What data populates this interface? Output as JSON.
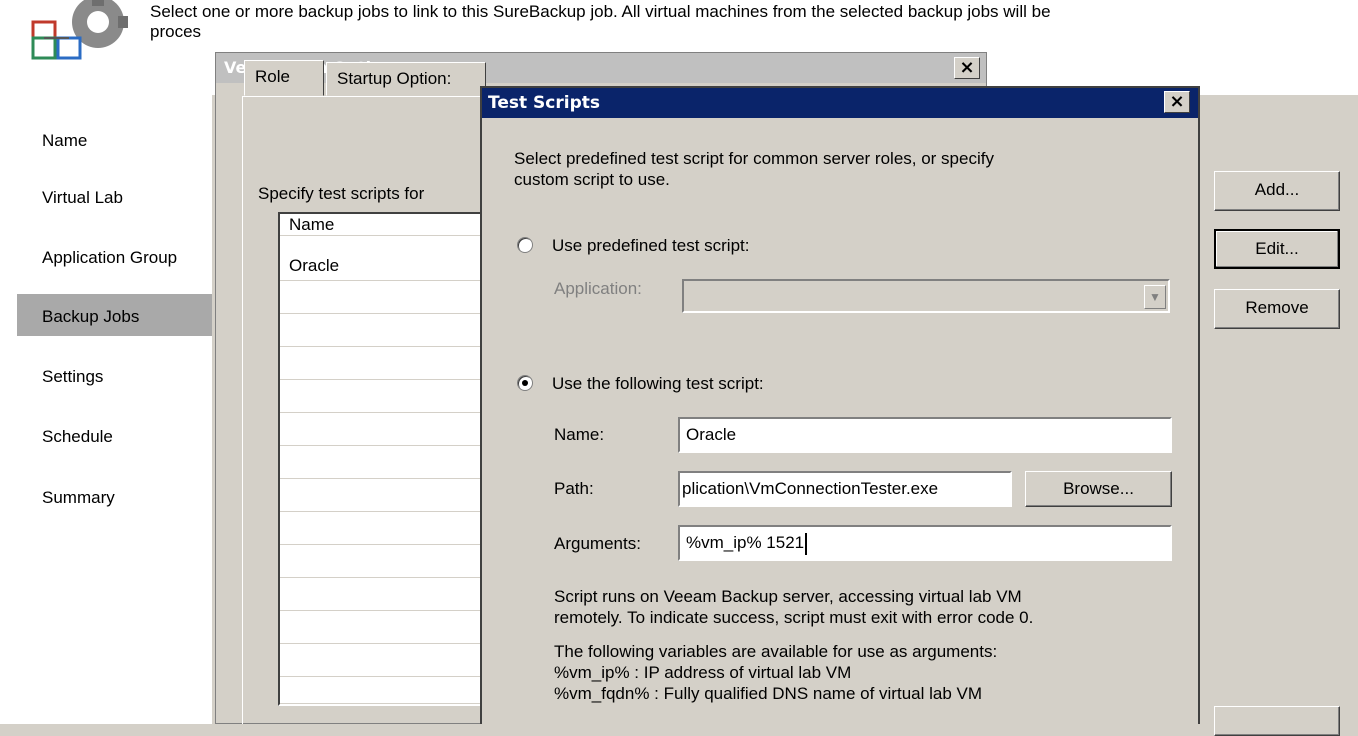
{
  "header": {
    "description": "Select one or more backup jobs to link to this SureBackup job. All virtual machines from the selected backup jobs will be",
    "description_cont": "proces"
  },
  "nav": {
    "items": [
      "Name",
      "Virtual Lab",
      "Application Group",
      "Backup Jobs",
      "Settings",
      "Schedule",
      "Summary"
    ],
    "active": "Backup Jobs"
  },
  "buttons": {
    "add": "Add...",
    "edit": "Edit...",
    "remove": "Remove"
  },
  "verification_dialog": {
    "title": "Verification Options",
    "close": "×",
    "tabs": [
      "Role",
      "Startup Options"
    ],
    "tab_visible": [
      "Role",
      "Startup Option:"
    ],
    "instruction": "Specify test scripts for",
    "list_header": "Name",
    "list_rows": [
      "Oracle"
    ]
  },
  "test_scripts_dialog": {
    "title": "Test Scripts",
    "close": "×",
    "intro_line1": "Select predefined test script for common server roles, or specify",
    "intro_line2": "custom script to use.",
    "predefined_label": "Use predefined test script:",
    "application_label": "Application:",
    "application_value": "",
    "custom_label": "Use the following test script:",
    "selected_option": "custom",
    "name_label": "Name:",
    "name_value": "Oracle",
    "path_label": "Path:",
    "path_value": "plication\\VmConnectionTester.exe",
    "browse_label": "Browse...",
    "arguments_label": "Arguments:",
    "arguments_value": "%vm_ip% 1521",
    "note_line1": "Script runs on Veeam Backup server, accessing virtual lab VM",
    "note_line2": "remotely. To indicate success, script must exit with error code 0.",
    "vars_line1": "The following variables are available for use as arguments:",
    "vars_line2": "%vm_ip% : IP address of virtual lab VM",
    "vars_line3": "%vm_fqdn% : Fully qualified DNS name of virtual lab VM"
  },
  "colors": {
    "active_title_bar": "#0a246a",
    "inactive_title_bar": "#c0c0c0",
    "nav_selected": "#a9a9a9",
    "dialog_face": "#d4d0c8"
  }
}
